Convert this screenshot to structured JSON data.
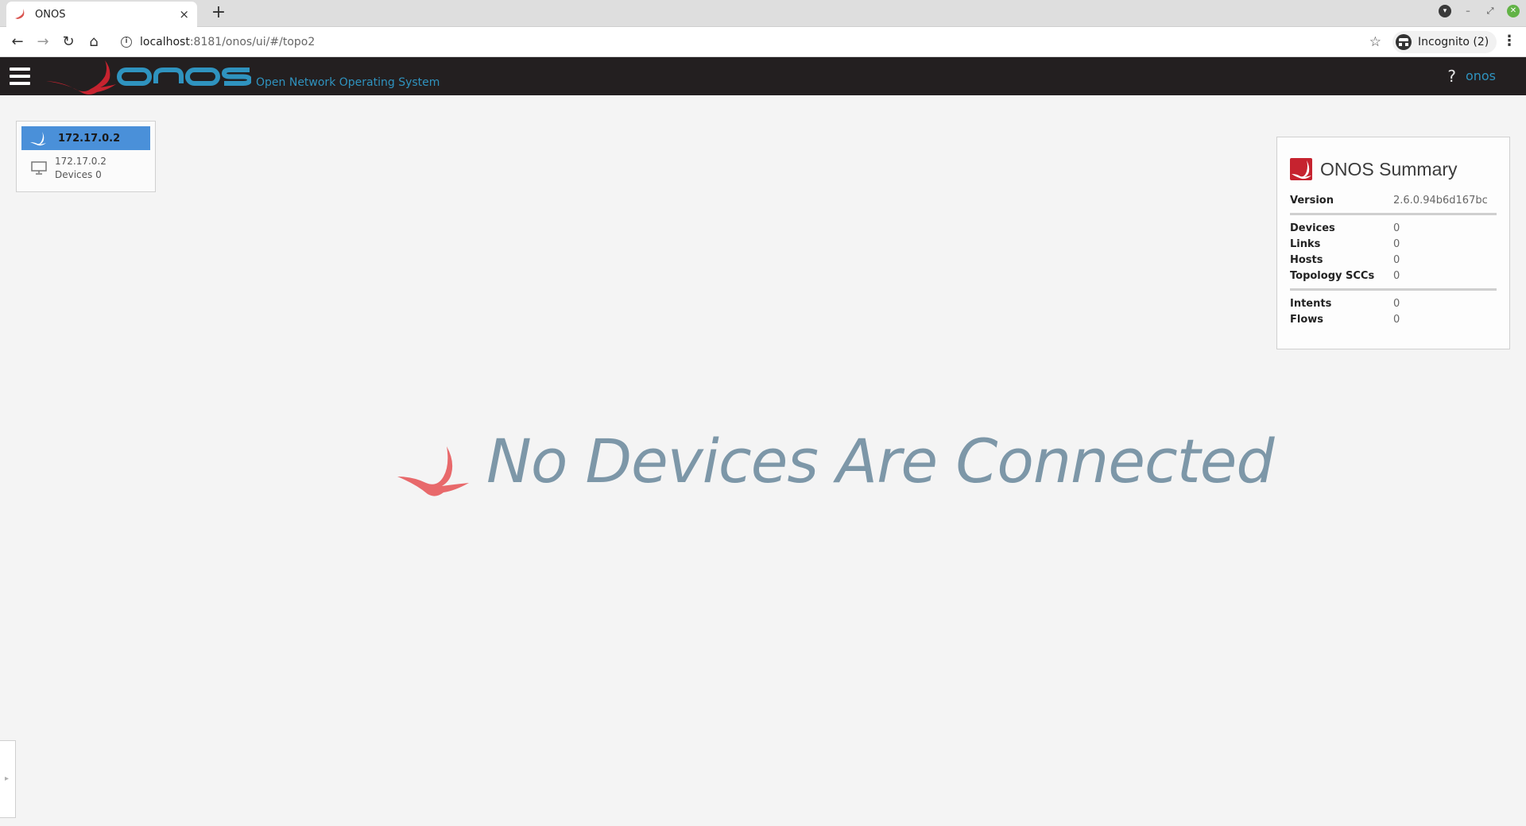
{
  "browser": {
    "tab_title": "ONOS",
    "tab_close": "×",
    "new_tab": "+",
    "url_host": "localhost",
    "url_rest": ":8181/onos/ui/#/topo2",
    "incognito_label": "Incognito (2)"
  },
  "masthead": {
    "tagline": "Open Network Operating System",
    "help": "?",
    "user": "onos"
  },
  "cluster": {
    "node_label": "172.17.0.2",
    "node_ip": "172.17.0.2",
    "devices_text": "Devices 0"
  },
  "summary": {
    "title": "ONOS Summary",
    "version_label": "Version",
    "version_value": "2.6.0.94b6d167bc",
    "stats1": [
      {
        "label": "Devices",
        "value": "0"
      },
      {
        "label": "Links",
        "value": "0"
      },
      {
        "label": "Hosts",
        "value": "0"
      },
      {
        "label": "Topology SCCs",
        "value": "0"
      }
    ],
    "stats2": [
      {
        "label": "Intents",
        "value": "0"
      },
      {
        "label": "Flows",
        "value": "0"
      }
    ]
  },
  "message": "No Devices Are Connected",
  "colors": {
    "masthead_bg": "#231f20",
    "brand_blue": "#2f93bf",
    "brand_red": "#c6232f",
    "node_blue": "#4a90d9",
    "message_gray": "#7d97a8"
  }
}
